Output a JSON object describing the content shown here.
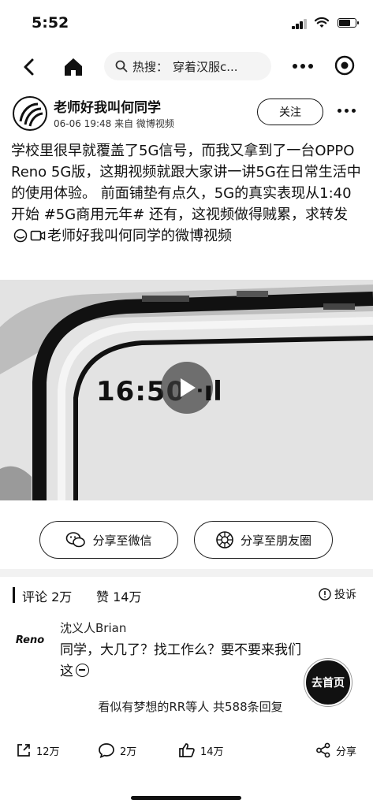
{
  "status_bar": {
    "time": "5:52",
    "battery_level": 0.7
  },
  "nav": {
    "search_prefix": "热搜：",
    "search_query": "穿着汉服c..."
  },
  "post": {
    "author": "老师好我叫何同学",
    "meta": "06-06 19:48 来自 微博视频",
    "follow_label": "关注",
    "text": "学校里很早就覆盖了5G信号，而我又拿到了一台OPPO Reno 5G版，这期视频就跟大家讲一讲5G在日常生活中的使用体验。 前面铺垫有点久，5G的真实表现从1:40开始 #5G商用元年# 还有，这视频做得贼累，求转发",
    "link_text": "老师好我叫何同学的微博视频",
    "video_overlay_time": "16:50",
    "video_overlay_signal": "ᐧıl"
  },
  "share": {
    "wechat_label": "分享至微信",
    "moments_label": "分享至朋友圈"
  },
  "comments": {
    "tab_comments": "评论 2万",
    "tab_likes": "赞 14万",
    "report_label": "投诉",
    "items": [
      {
        "avatar_text": "Reno",
        "user": "沈义人Brian",
        "text": "同学，大几了？找工作么？要不要来我们这"
      }
    ],
    "reply_summary": "看似有梦想的RR等人 共588条回复",
    "go_home_label": "去首页"
  },
  "bottom_bar": {
    "repost_count": "12万",
    "comment_count": "2万",
    "like_count": "14万",
    "share_label": "分享"
  }
}
